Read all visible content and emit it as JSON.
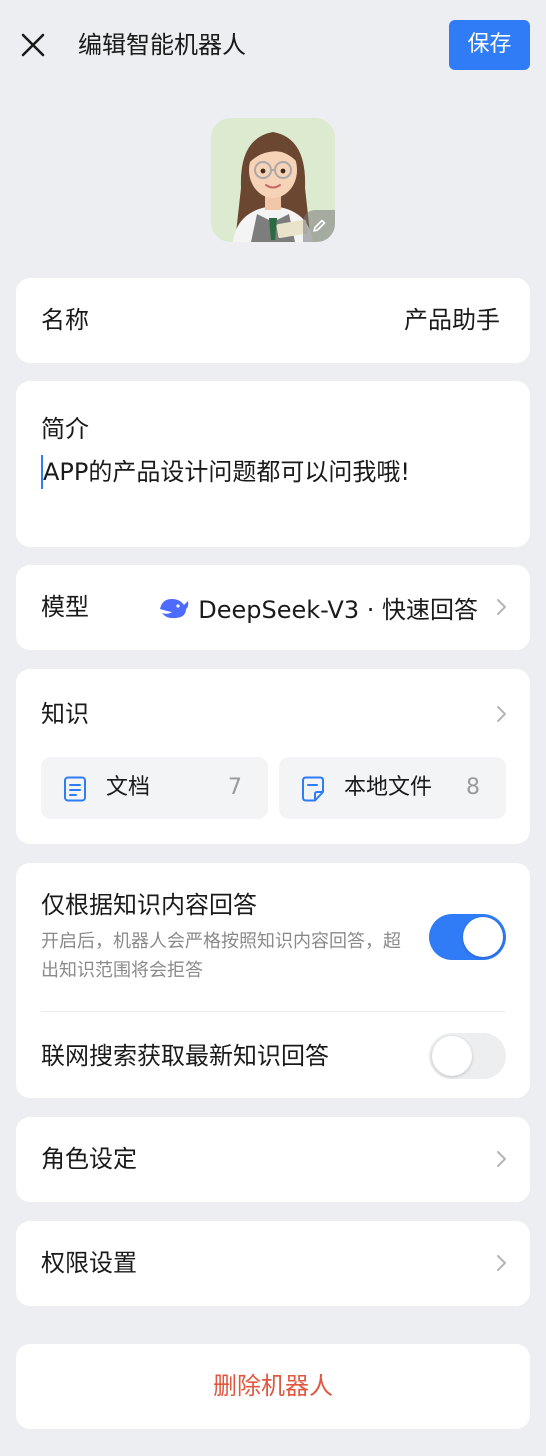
{
  "header": {
    "title": "编辑智能机器人",
    "save_label": "保存"
  },
  "colors": {
    "accent": "#2f7cf6",
    "danger": "#e0583f",
    "background": "#eceef2"
  },
  "name_row": {
    "label": "名称",
    "value": "产品助手"
  },
  "intro": {
    "label": "简介",
    "text": "APP的产品设计问题都可以问我哦!"
  },
  "model": {
    "label": "模型",
    "value": "DeepSeek-V3 · 快速回答",
    "icon": "deepseek-whale-icon"
  },
  "knowledge": {
    "label": "知识",
    "items": [
      {
        "label": "文档",
        "count": "7",
        "icon": "document-icon"
      },
      {
        "label": "本地文件",
        "count": "8",
        "icon": "local-file-icon"
      }
    ]
  },
  "toggles": {
    "knowledge_only": {
      "label": "仅根据知识内容回答",
      "description": "开启后，机器人会严格按照知识内容回答，超出知识范围将会拒答",
      "enabled": true
    },
    "web_search": {
      "label": "联网搜索获取最新知识回答",
      "enabled": false
    }
  },
  "role_row": {
    "label": "角色设定"
  },
  "permission_row": {
    "label": "权限设置"
  },
  "delete": {
    "label": "删除机器人"
  }
}
